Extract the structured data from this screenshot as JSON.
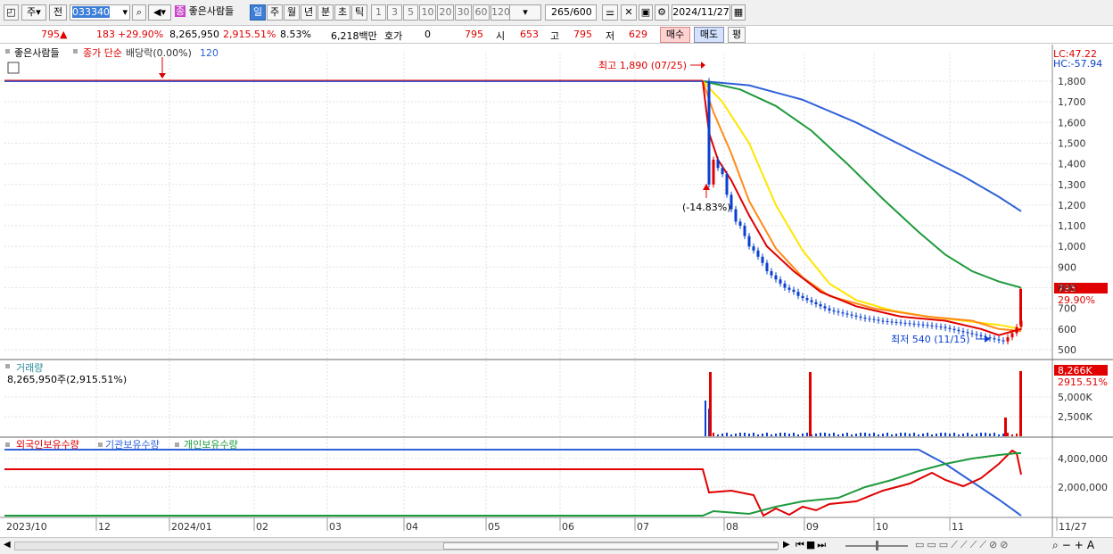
{
  "toolbar": {
    "mode_label": "주",
    "prev_label": "전",
    "code": "033340",
    "stock_name": "좋은사람들",
    "period_tabs": [
      "일",
      "주",
      "월",
      "년",
      "분",
      "초",
      "틱"
    ],
    "active_period": "일",
    "intervals": [
      "1",
      "3",
      "5",
      "10",
      "20",
      "30",
      "60",
      "120"
    ],
    "count": "265",
    "count_max": "/600",
    "date": "2024/11/27"
  },
  "quote": {
    "price": "795",
    "arrow": "▲",
    "change": "183",
    "change_pct": "+29.90%",
    "volume": "8,265,950",
    "volume_pct": "2,915.51%",
    "turnover_pct": "8.53%",
    "amount": "6,218백만",
    "hoga_label": "호가",
    "hoga_value": "0",
    "hoga_price": "795",
    "open_label": "시",
    "open": "653",
    "high_label": "고",
    "high": "795",
    "low_label": "저",
    "low": "629",
    "buy_label": "매수",
    "sell_label": "매도",
    "avg_label": "평"
  },
  "price_panel": {
    "name": "좋은사람들",
    "legend_text": "종가 단순",
    "legend_rate": "배당락(0.00%)",
    "legend_120": "120",
    "lc": "LC:47.22",
    "hc": "HC:-57.94",
    "max_label": "최고 1,890 (07/25)",
    "min_label": "최저 540 (11/15)",
    "drop_label": "(-14.83%)",
    "price_tag": "795",
    "pct_tag": "29.90%",
    "yticks": [
      "1,800",
      "1,700",
      "1,600",
      "1,500",
      "1,400",
      "1,300",
      "1,200",
      "1,100",
      "1,000",
      "900",
      "800",
      "700",
      "600",
      "500"
    ]
  },
  "volume_panel": {
    "title": "거래량",
    "value": "8,265,950주(2,915.51%)",
    "tag_value": "8,266K",
    "tag_pct": "2915.51%",
    "yticks": [
      "5,000K",
      "2,500K"
    ]
  },
  "holding_panel": {
    "foreign": "외국인보유수량",
    "institution": "기관보유수량",
    "individual": "개인보유수량",
    "yticks": [
      "4,000,000",
      "2,000,000"
    ]
  },
  "xaxis": [
    "2023/10",
    "12",
    "2024/01",
    "02",
    "03",
    "04",
    "05",
    "06",
    "07",
    "08",
    "09",
    "10",
    "11",
    "11/27"
  ],
  "colors": {
    "up": "#e00000",
    "down": "#0a3fd0",
    "ma5": "#e00000",
    "ma10": "#ff8c1a",
    "ma20": "#ffe600",
    "ma60": "#1e9a3c",
    "ma120": "#2f62d8"
  },
  "chart_data": {
    "type": "line",
    "x_range": [
      "2023/10",
      "2024/11/27"
    ],
    "y_range": [
      460,
      1900
    ],
    "series": [
      {
        "values": [
          1800,
          1800,
          1800,
          1390,
          1200,
          1000,
          760,
          680,
          640,
          620,
          560,
          795
        ]
      },
      {
        "name": "120",
        "values": [
          1800,
          1800,
          1800,
          1790,
          1720,
          1600,
          1480,
          1360,
          1230,
          1120
        ]
      }
    ],
    "max": {
      "price": 1890,
      "date": "07/25"
    },
    "min": {
      "price": 540,
      "date": "11/15"
    },
    "last": 795
  }
}
